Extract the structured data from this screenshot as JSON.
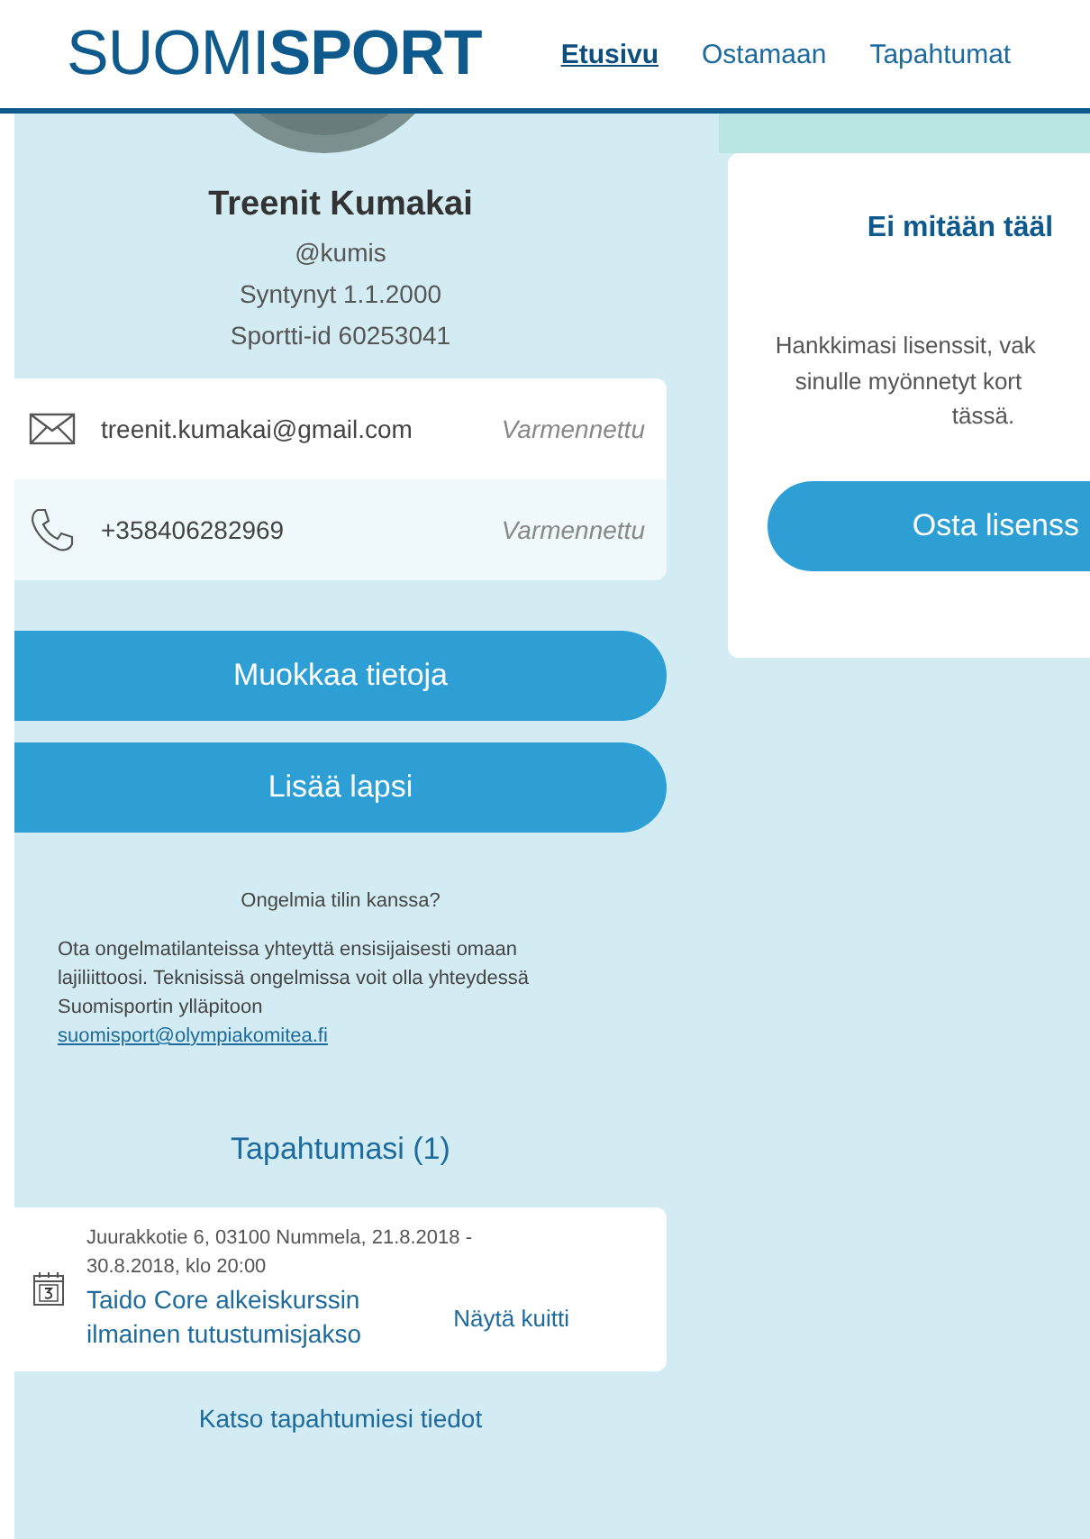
{
  "header": {
    "logo_light": "SUOMI",
    "logo_bold": "SPORT",
    "nav": [
      {
        "label": "Etusivu",
        "selected": true
      },
      {
        "label": "Ostamaan",
        "selected": false
      },
      {
        "label": "Tapahtumat",
        "selected": false
      }
    ]
  },
  "profile": {
    "name": "Treenit Kumakai",
    "username": "@kumis",
    "born": "Syntynyt 1.1.2000",
    "sport_id": "Sportti-id 60253041"
  },
  "contacts": [
    {
      "kind": "email",
      "value": "treenit.kumakai@gmail.com",
      "status": "Varmennettu"
    },
    {
      "kind": "phone",
      "value": "+358406282969",
      "status": "Varmennettu"
    }
  ],
  "buttons": [
    "Muokkaa tietoja",
    "Lisää lapsi"
  ],
  "help": {
    "title": "Ongelmia tilin kanssa?",
    "text": "Ota ongelmatilanteissa yhteyttä ensisijaisesti omaan lajiliittoosi. Teknisissä ongelmissa voit olla yhteydessä Suomisportin ylläpitoon",
    "email": "suomisport@olympiakomitea.fi"
  },
  "events": {
    "title": "Tapahtumasi (1)",
    "items": [
      {
        "place_time": "Juurakkotie 6, 03100 Nummela, 21.8.2018 - 30.8.2018, klo 20:00",
        "name": "Taido Core alkeiskurssin ilmainen tutustumisjakso",
        "action": "Näytä kuitti"
      }
    ],
    "more": "Katso tapahtumiesi tiedot"
  },
  "licenses": {
    "title": "Ei mitään tääl",
    "text_lines": [
      "Hankkimasi lisenssit, vak",
      "sinulle myönnetyt kort",
      "tässä."
    ],
    "button": "Osta lisenss"
  }
}
